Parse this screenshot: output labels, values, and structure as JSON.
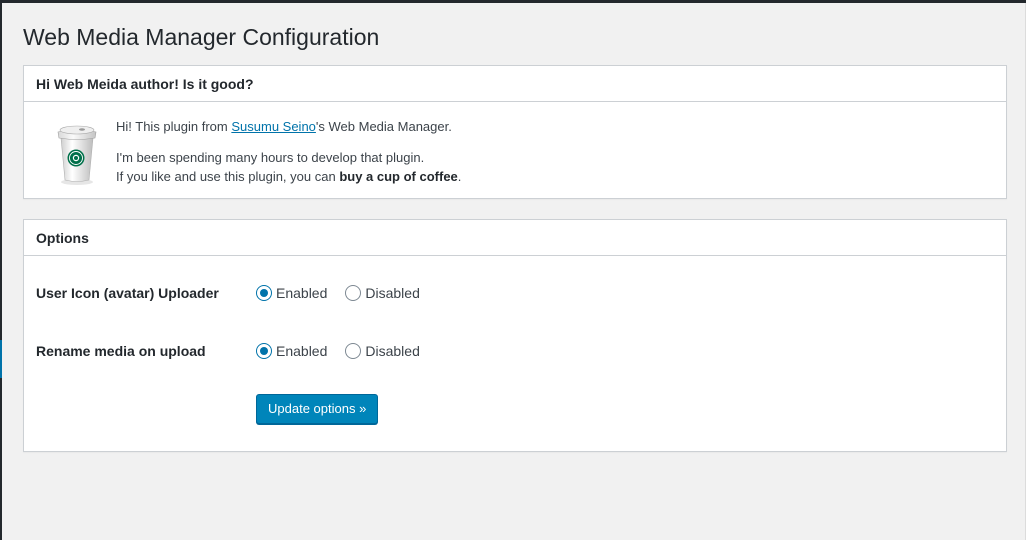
{
  "page": {
    "title": "Web Media Manager Configuration"
  },
  "author_box": {
    "heading": "Hi Web Meida author! Is it good?",
    "line1_prefix": "Hi! This plugin from ",
    "author_link": "Susumu Seino",
    "line1_suffix": "'s Web Media Manager.",
    "line2": "I'm been spending many hours to develop that plugin.",
    "line3_prefix": "If you like and use this plugin, you can ",
    "line3_bold": "buy a cup of coffee",
    "line3_suffix": ".",
    "image_icon": "coffee-cup-icon"
  },
  "options_box": {
    "heading": "Options",
    "rows": [
      {
        "label": "User Icon (avatar) Uploader",
        "enabled_label": "Enabled",
        "disabled_label": "Disabled",
        "selected": "Enabled"
      },
      {
        "label": "Rename media on upload",
        "enabled_label": "Enabled",
        "disabled_label": "Disabled",
        "selected": "Enabled"
      }
    ],
    "submit_label": "Update options »"
  },
  "colors": {
    "accent": "#0073aa",
    "button": "#0085ba",
    "background": "#f1f1f1",
    "admin_bar": "#23282d"
  }
}
